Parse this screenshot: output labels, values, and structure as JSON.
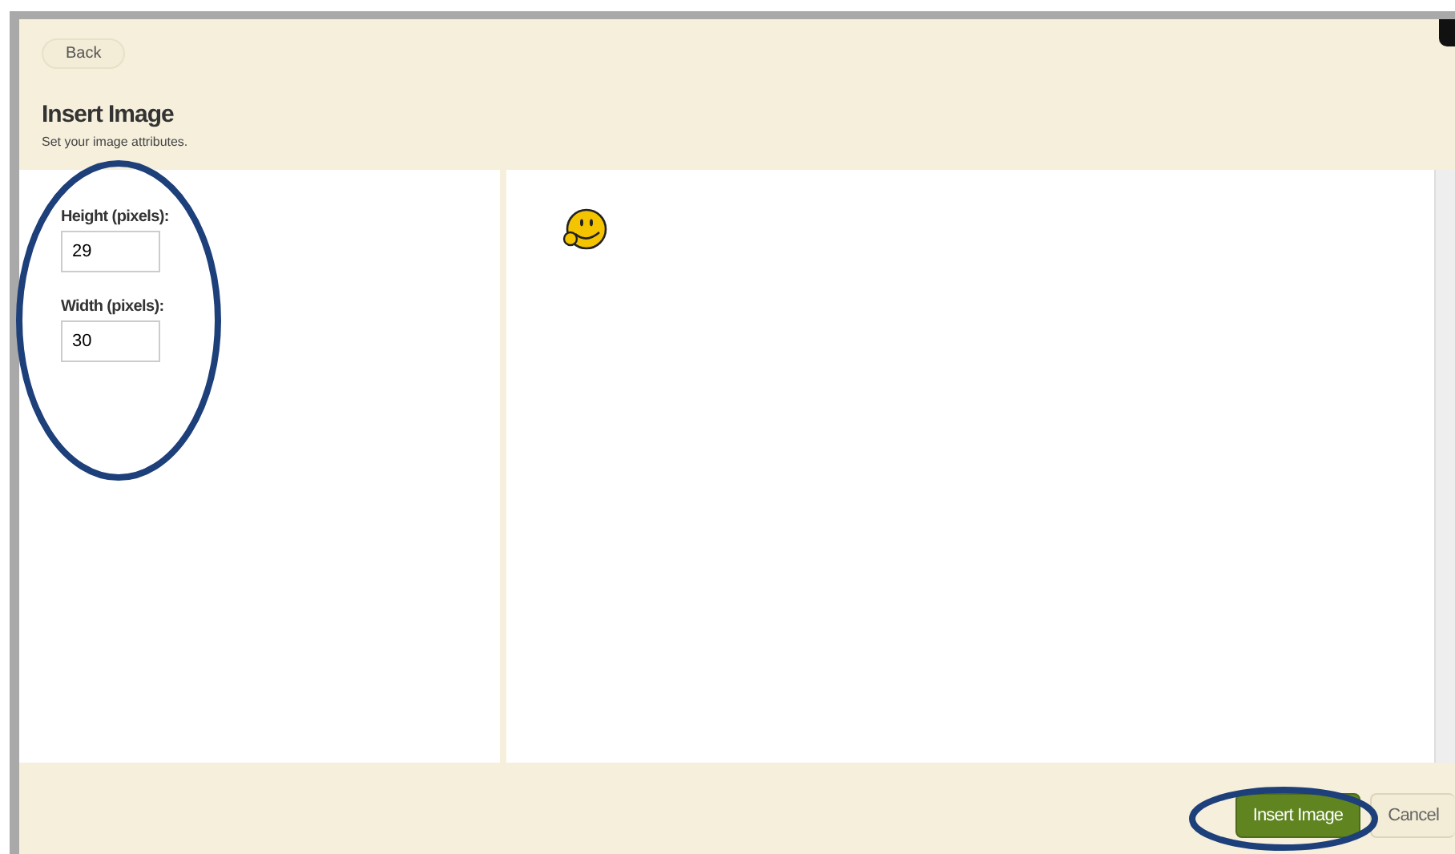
{
  "back_button": "Back",
  "title": "Insert Image",
  "subtitle": "Set your image attributes.",
  "fields": [
    {
      "label": "Height (pixels):",
      "value": "29"
    },
    {
      "label": "Width (pixels):",
      "value": "30"
    }
  ],
  "buttons": [
    {
      "label": "Insert Image",
      "kind": "primary"
    },
    {
      "label": "Cancel",
      "kind": "secondary"
    }
  ]
}
